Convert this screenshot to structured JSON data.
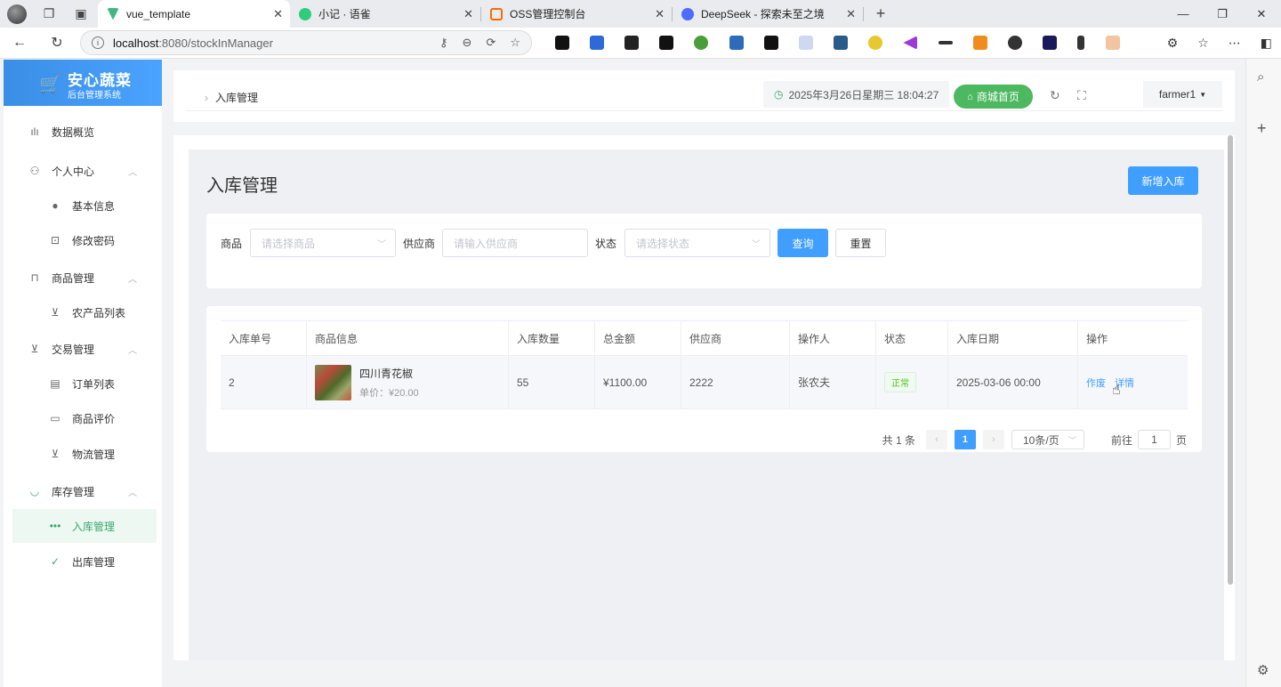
{
  "browser": {
    "tabs": [
      {
        "title": "vue_template",
        "active": true,
        "color": "#41b883"
      },
      {
        "title": "小记 · 语雀",
        "active": false,
        "color": "#31cc79"
      },
      {
        "title": "OSS管理控制台",
        "active": false,
        "color": "#ff6a00"
      },
      {
        "title": "DeepSeek - 探索未至之境",
        "active": false,
        "color": "#4d6bfe"
      }
    ],
    "url_host": "localhost",
    "url_path": ":8080/stockInManager"
  },
  "sidebar": {
    "logo_title": "安心蔬菜",
    "logo_sub": "后台管理系统",
    "items": [
      {
        "label": "数据概览",
        "icon": "bar-chart-icon",
        "glyph": "ılı"
      },
      {
        "label": "个人中心",
        "icon": "user-icon",
        "glyph": "⚇"
      },
      {
        "label": "基本信息",
        "icon": "info-icon",
        "glyph": "●"
      },
      {
        "label": "修改密码",
        "icon": "lock-icon",
        "glyph": "⊡"
      },
      {
        "label": "商品管理",
        "icon": "bag-icon",
        "glyph": "⊓"
      },
      {
        "label": "农产品列表",
        "icon": "cart-icon",
        "glyph": "⊻"
      },
      {
        "label": "交易管理",
        "icon": "cart-icon",
        "glyph": "⊻"
      },
      {
        "label": "订单列表",
        "icon": "document-icon",
        "glyph": "▤"
      },
      {
        "label": "商品评价",
        "icon": "comment-icon",
        "glyph": "▭"
      },
      {
        "label": "物流管理",
        "icon": "truck-icon",
        "glyph": "⊻"
      },
      {
        "label": "库存管理",
        "icon": "bowl-icon",
        "glyph": "◡"
      },
      {
        "label": "入库管理",
        "icon": "more-icon",
        "glyph": "•••"
      },
      {
        "label": "出库管理",
        "icon": "check-icon",
        "glyph": "✓"
      }
    ]
  },
  "header": {
    "breadcrumb": "入库管理",
    "datetime": "2025年3月26日星期三 18:04:27",
    "shop_label": "商城首页",
    "username": "farmer1"
  },
  "page": {
    "title": "入库管理",
    "new_button": "新增入库"
  },
  "filters": {
    "product_label": "商品",
    "product_placeholder": "请选择商品",
    "supplier_label": "供应商",
    "supplier_placeholder": "请输入供应商",
    "status_label": "状态",
    "status_placeholder": "请选择状态",
    "query_button": "查询",
    "reset_button": "重置"
  },
  "table": {
    "headers": [
      "入库单号",
      "商品信息",
      "入库数量",
      "总金额",
      "供应商",
      "操作人",
      "状态",
      "入库日期",
      "操作"
    ],
    "rows": [
      {
        "id": "2",
        "product_name": "四川青花椒",
        "unit_price": "单价：¥20.00",
        "quantity": "55",
        "total": "¥1100.00",
        "supplier": "2222",
        "operator": "张农夫",
        "status": "正常",
        "date": "2025-03-06 00:00",
        "op_void": "作废",
        "op_detail": "详情"
      }
    ]
  },
  "pagination": {
    "total": "共 1 条",
    "current": "1",
    "page_size": "10条/页",
    "goto_label": "前往",
    "goto_value": "1",
    "page_unit": "页"
  }
}
